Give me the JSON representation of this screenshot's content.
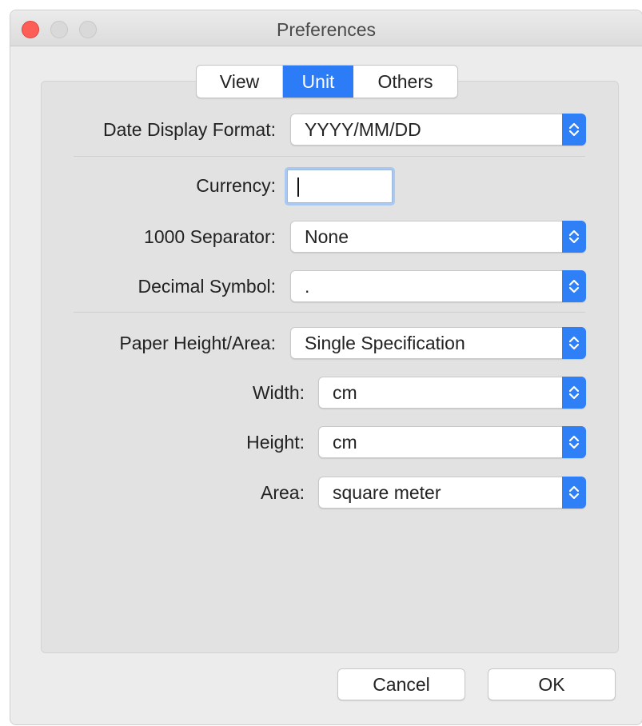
{
  "window": {
    "title": "Preferences"
  },
  "tabs": [
    {
      "label": "View",
      "selected": false
    },
    {
      "label": "Unit",
      "selected": true
    },
    {
      "label": "Others",
      "selected": false
    }
  ],
  "form": {
    "date_display_format": {
      "label": "Date Display Format:",
      "value": "YYYY/MM/DD"
    },
    "currency": {
      "label": "Currency:",
      "value": ""
    },
    "thousand_separator": {
      "label": "1000 Separator:",
      "value": "None"
    },
    "decimal_symbol": {
      "label": "Decimal Symbol:",
      "value": "."
    },
    "paper_height_area": {
      "label": "Paper Height/Area:",
      "value": "Single Specification"
    },
    "width": {
      "label": "Width:",
      "value": "cm"
    },
    "height": {
      "label": "Height:",
      "value": "cm"
    },
    "area": {
      "label": "Area:",
      "value": "square meter"
    }
  },
  "buttons": {
    "cancel": "Cancel",
    "ok": "OK"
  },
  "colors": {
    "accent": "#2b7cf6",
    "close_light": "#fd5f57"
  },
  "icons": {
    "popup_arrows": "chevron-up-down-icon"
  }
}
